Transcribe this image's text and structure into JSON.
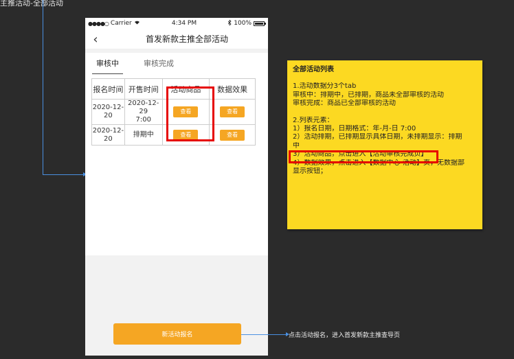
{
  "top_cut_text": "主推活动-全部活动",
  "status_bar": {
    "carrier": "Carrier",
    "wifi_icon": "wifi-icon",
    "time": "4:34 PM",
    "battery_pct": "100%",
    "battery_level": 1.0
  },
  "nav": {
    "back_glyph": "‹",
    "title": "首发新款主推全部活动"
  },
  "tabs": [
    {
      "label": "审核中",
      "active": true
    },
    {
      "label": "审核完成",
      "active": false
    }
  ],
  "table": {
    "headers": [
      "报名时间",
      "开售时间",
      "活动商品",
      "数据效果"
    ],
    "rows": [
      {
        "signup": "2020-12-\n20",
        "sale": "2020-12-29\n7:00",
        "product_btn": "查看",
        "data_btn": "查看"
      },
      {
        "signup": "2020-12-\n20",
        "sale": "排期中",
        "product_btn": "查看",
        "data_btn": "查看"
      }
    ]
  },
  "register_button": "新活动报名",
  "arrow_note": "点击活动报名，进入首发新款主推查导页",
  "sticky": {
    "title": "全部活动列表",
    "lines1": [
      "1.活动数据分3个tab",
      "审核中：排期中，已排期，商品未全部审核的活动",
      "审核完成：商品已全部审核的活动"
    ],
    "lines2": [
      "2.列表元素：",
      "1）报名日期，日期格式：年-月-日 7:00",
      "2）活动排期，已排期显示具体日期，未排期显示：排期",
      "中",
      "3）活动商品，点击进入【活动审核完成页】",
      "4）数据效果，点击进入【数据中心-活动】页，无数据部",
      "显示按钮；"
    ]
  },
  "colors": {
    "accent": "#f5a623",
    "highlight": "#e60000",
    "sticky": "#fcd922",
    "connector": "#4a90e2"
  }
}
